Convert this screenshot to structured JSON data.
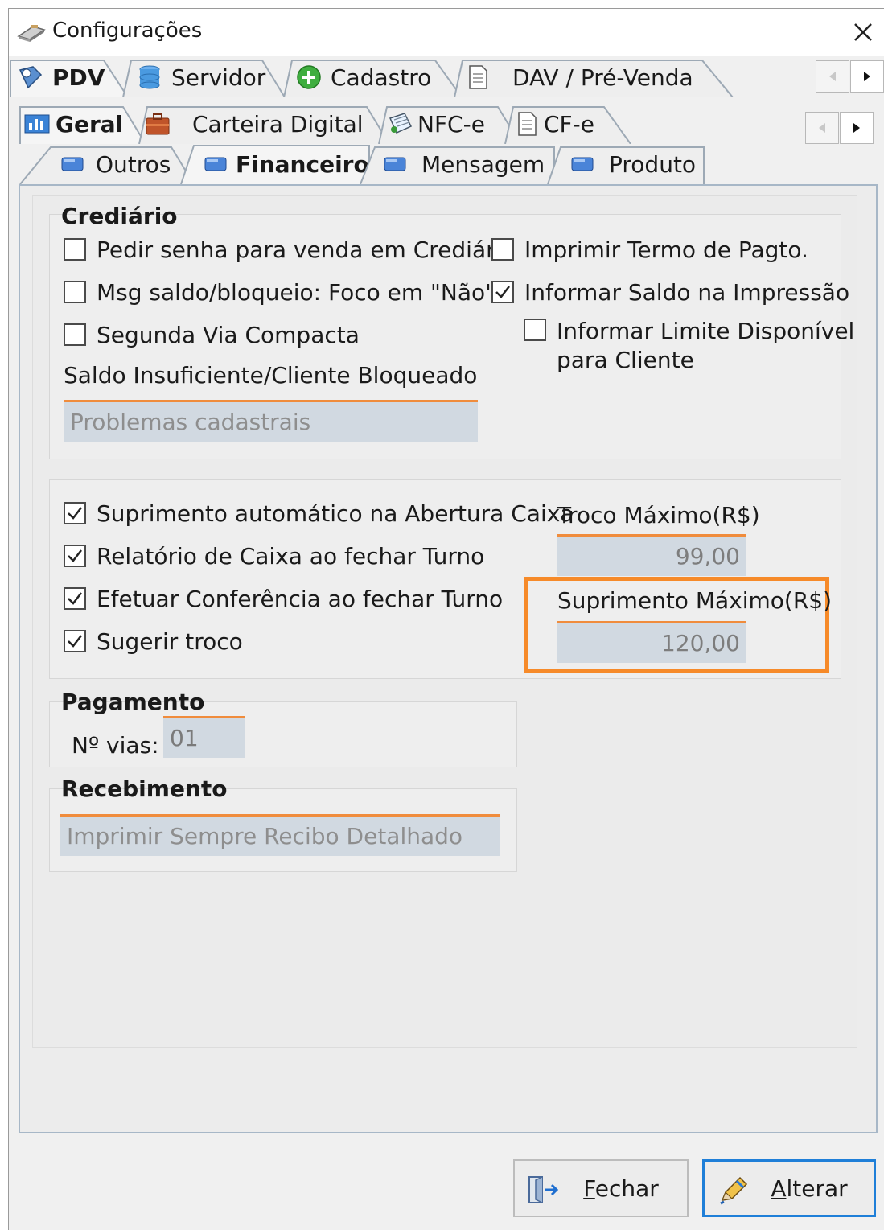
{
  "window": {
    "title": "Configurações"
  },
  "tabs_level1": [
    {
      "label": "PDV",
      "icon": "pdv-icon",
      "active": true
    },
    {
      "label": "Servidor",
      "icon": "database-icon"
    },
    {
      "label": "Cadastro",
      "icon": "plus-circle-icon"
    },
    {
      "label": "DAV / Pré-Venda",
      "icon": "document-icon"
    }
  ],
  "tabs_level2": [
    {
      "label": "Geral",
      "icon": "chart-icon",
      "active": true
    },
    {
      "label": "Carteira Digital",
      "icon": "briefcase-icon"
    },
    {
      "label": "NFC-e",
      "icon": "receipt-icon"
    },
    {
      "label": "CF-e",
      "icon": "document-icon"
    }
  ],
  "tabs_level3": [
    {
      "label": "Outros"
    },
    {
      "label": "Financeiro",
      "active": true
    },
    {
      "label": "Mensagem"
    },
    {
      "label": "Produto"
    }
  ],
  "crediario": {
    "title": "Crediário",
    "checkboxes": [
      {
        "label": "Pedir senha para venda em Crediário",
        "checked": false
      },
      {
        "label": "Imprimir Termo de Pagto.",
        "checked": false
      },
      {
        "label": "Msg saldo/bloqueio: Foco em \"Não\"",
        "checked": false
      },
      {
        "label": "Informar Saldo na Impressão",
        "checked": true
      },
      {
        "label": "Segunda Via Compacta",
        "checked": false
      },
      {
        "label": "Informar Limite Disponível",
        "label2": "para Cliente",
        "checked": false
      }
    ],
    "saldo_label": "Saldo Insuficiente/Cliente Bloqueado",
    "saldo_value": "Problemas cadastrais"
  },
  "caixa": {
    "checkboxes": [
      {
        "label": "Suprimento automático na Abertura Caixa",
        "checked": true
      },
      {
        "label": "Relatório de Caixa ao fechar Turno",
        "checked": true
      },
      {
        "label": "Efetuar Conferência ao fechar Turno",
        "checked": true
      },
      {
        "label": "Sugerir troco",
        "checked": true
      }
    ],
    "troco_label": "Troco Máximo(R$)",
    "troco_value": "99,00",
    "suprimento_label": "Suprimento Máximo(R$)",
    "suprimento_value": "120,00"
  },
  "pagamento": {
    "title": "Pagamento",
    "vias_label": "Nº vias:",
    "vias_value": "01"
  },
  "recebimento": {
    "title": "Recebimento",
    "value": "Imprimir Sempre Recibo Detalhado"
  },
  "buttons": {
    "fechar": {
      "accel": "F",
      "rest": "echar"
    },
    "alterar": {
      "accel": "A",
      "rest": "lterar"
    }
  },
  "colors": {
    "highlight": "#f68a29",
    "field_bg": "#d1d9e1",
    "field_border": "#f08c3c",
    "primary_border": "#1f7fd8"
  }
}
